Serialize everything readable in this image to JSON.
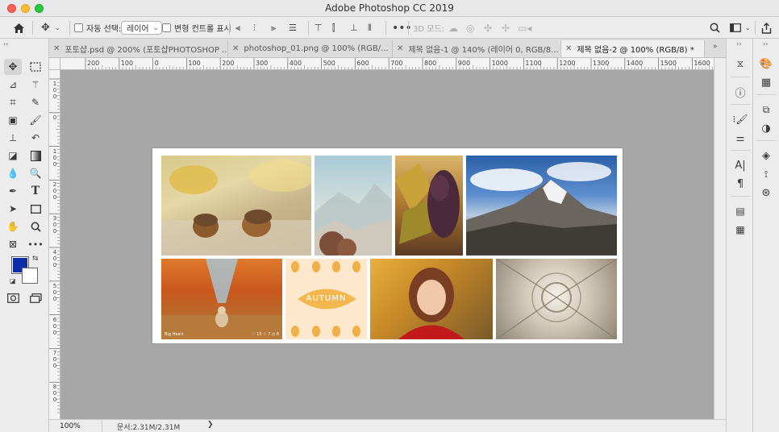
{
  "window": {
    "title": "Adobe Photoshop CC 2019"
  },
  "options_bar": {
    "auto_select_label": "자동 선택:",
    "auto_select_value": "레이어",
    "transform_controls_label": "변형 컨트롤 표시",
    "mode_3d_label": "3D 모드:"
  },
  "tabs": [
    {
      "label": "포토샵.psd @ 200% (포토샵PHOTOSHOP ...",
      "active": false
    },
    {
      "label": "photoshop_01.png @ 100% (RGB/...",
      "active": false
    },
    {
      "label": "제목 없음-1 @ 140% (레이어 0, RGB/8...",
      "active": false
    },
    {
      "label": "제목 없음-2 @ 100% (RGB/8) *",
      "active": true
    }
  ],
  "ruler_top_labels": [
    "200",
    "100",
    "0",
    "100",
    "200",
    "300",
    "400",
    "500",
    "600",
    "700",
    "800",
    "900",
    "1000",
    "1100",
    "1200",
    "1300",
    "1400",
    "1500",
    "1600"
  ],
  "ruler_left_labels": [
    "100",
    "0",
    "100",
    "200",
    "300",
    "400",
    "500",
    "600",
    "700",
    "800"
  ],
  "status": {
    "zoom": "100%",
    "doc_size": "문서:2.31M/2.31M",
    "arrow": "❯"
  },
  "colors": {
    "foreground": "#0c2ea8",
    "background": "#ffffff"
  },
  "canvas": {
    "tile_texts": {
      "autumn": "AUTUMN",
      "watermark": "Big Heart",
      "stats": "♡ 13   ☆ 7   ◷ 6"
    }
  }
}
